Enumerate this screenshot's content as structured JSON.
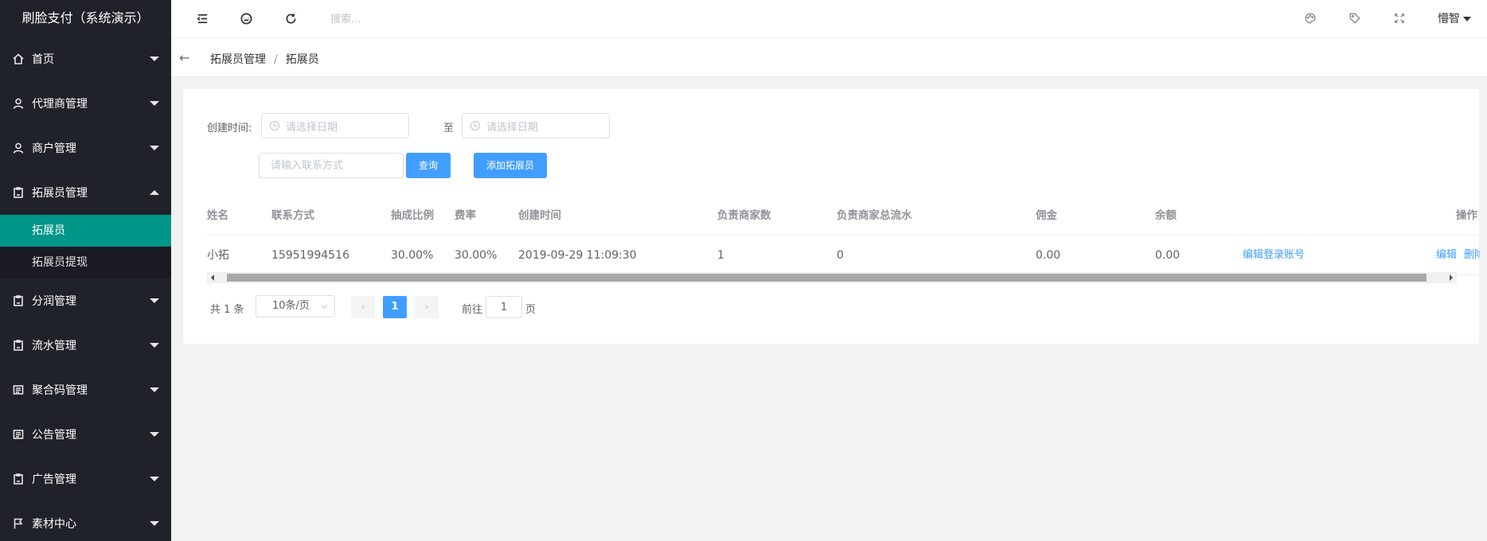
{
  "app": {
    "title": "刷脸支付（系统演示）"
  },
  "header": {
    "search_placeholder": "搜索...",
    "user_name": "懵智"
  },
  "sidebar": {
    "items": [
      {
        "label": "首页",
        "icon": "home-icon",
        "expanded": false
      },
      {
        "label": "代理商管理",
        "icon": "user-icon",
        "expanded": false
      },
      {
        "label": "商户管理",
        "icon": "user-icon",
        "expanded": false
      },
      {
        "label": "拓展员管理",
        "icon": "clipboard-icon",
        "expanded": true,
        "children": [
          {
            "label": "拓展员",
            "active": true
          },
          {
            "label": "拓展员提现",
            "active": false
          }
        ]
      },
      {
        "label": "分润管理",
        "icon": "clipboard-icon",
        "expanded": false
      },
      {
        "label": "流水管理",
        "icon": "clipboard-icon",
        "expanded": false
      },
      {
        "label": "聚合码管理",
        "icon": "list-icon",
        "expanded": false
      },
      {
        "label": "公告管理",
        "icon": "list-icon",
        "expanded": false
      },
      {
        "label": "广告管理",
        "icon": "clipboard-icon",
        "expanded": false
      },
      {
        "label": "素材中心",
        "icon": "flag-icon",
        "expanded": false
      }
    ]
  },
  "breadcrumb": {
    "parent": "拓展员管理",
    "separator": "/",
    "current": "拓展员"
  },
  "filter": {
    "created_label": "创建时间:",
    "date_start_placeholder": "请选择日期",
    "range_separator": "至",
    "date_end_placeholder": "请选择日期",
    "contact_placeholder": "请输入联系方式",
    "query_button": "查询",
    "add_button": "添加拓展员"
  },
  "table": {
    "columns": [
      "姓名",
      "联系方式",
      "抽成比例",
      "费率",
      "创建时间",
      "负责商家数",
      "负责商家总流水",
      "佣金",
      "余额",
      "",
      "操作"
    ],
    "rows": [
      {
        "name": "小拓",
        "contact": "15951994516",
        "commission_ratio": "30.00%",
        "rate": "30.00%",
        "created_at": "2019-09-29 11:09:30",
        "merchant_count": "1",
        "merchant_total_flow": "0",
        "commission": "0.00",
        "balance": "0.00",
        "edit_login_link": "编辑登录账号",
        "edit_link": "编辑",
        "delete_link": "删除"
      }
    ]
  },
  "pagination": {
    "total_text": "共 1 条",
    "page_size": "10条/页",
    "current_page": "1",
    "goto_prefix": "前往",
    "goto_value": "1",
    "goto_suffix": "页"
  },
  "colors": {
    "sidebar_bg": "#20222a",
    "active_item": "#009688",
    "primary": "#409eff"
  }
}
